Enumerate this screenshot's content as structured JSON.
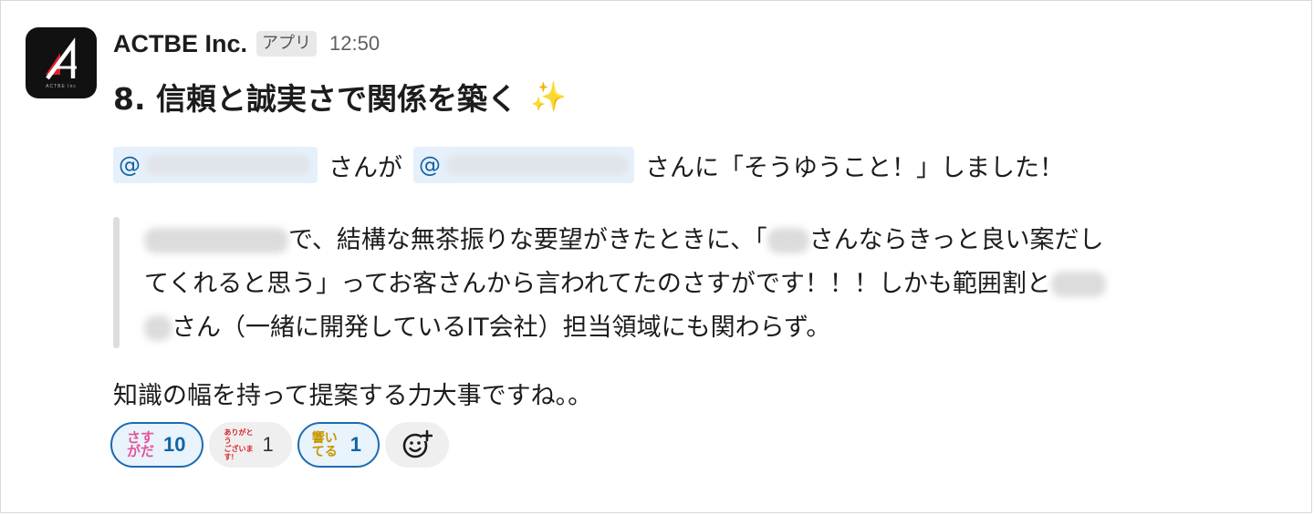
{
  "message": {
    "sender": "ACTBE Inc.",
    "app_badge": "アプリ",
    "timestamp": "12:50",
    "avatar_label": "ACTBE Inc",
    "title": "8. 信頼と誠実さで関係を築く",
    "title_emoji": "✨",
    "mention_line": {
      "mention_prefix": "@",
      "text_after_first": "さんが",
      "text_after_second": "さんに「そうゆうこと！」しました！"
    },
    "quote": {
      "line1_a": "で、結構な無茶振りな要望がきたときに、「",
      "line1_b": "さんならきっと良い案だし",
      "line2": "てくれると思う」ってお客さんから言われてたのさすがです！！！しかも範囲割と",
      "line3": "さん（一緒に開発しているIT会社）担当領域にも関わらず。"
    },
    "body": "知識の幅を持って提案する力大事ですね。。"
  },
  "reactions": [
    {
      "emoji": "sasuga-emoji",
      "emoji_text_top": "さす",
      "emoji_text_bottom": "がだ",
      "count": "10",
      "active": true
    },
    {
      "emoji": "arigato-emoji",
      "emoji_text_top": "ありがとう",
      "emoji_text_bottom": "ございます!",
      "count": "1",
      "active": false
    },
    {
      "emoji": "hibiite-emoji",
      "emoji_text_top": "響いてる",
      "emoji_text_bottom": "",
      "count": "1",
      "active": true
    }
  ],
  "colors": {
    "mention_bg": "#e6f0fa",
    "mention_text": "#1264a3",
    "reaction_active_border": "#1d6bb0",
    "quote_bar": "#dddddd"
  }
}
